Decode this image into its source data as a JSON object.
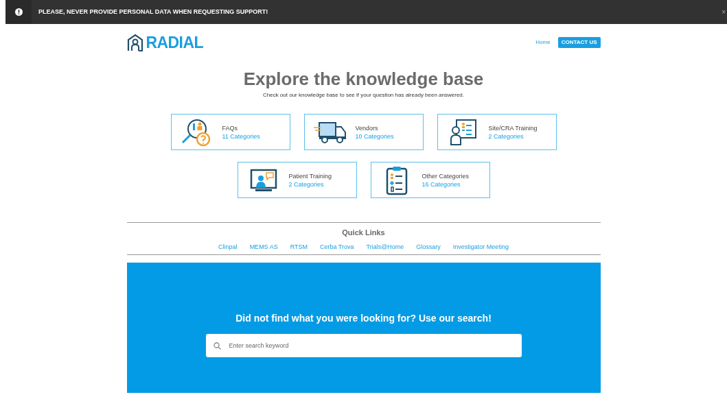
{
  "banner": {
    "text": "PLEASE, NEVER PROVIDE PERSONAL DATA WHEN REQUESTING SUPPORT!",
    "close": "×"
  },
  "header": {
    "logo": "RADIAL",
    "nav": [
      {
        "label": "Home",
        "kind": "link"
      },
      {
        "label": "CONTACT US",
        "kind": "button"
      }
    ]
  },
  "hero": {
    "title": "Explore the knowledge base",
    "subtitle": "Check out our knowledge base to see if your question has already been answered."
  },
  "cards": [
    [
      {
        "title": "FAQs",
        "count": "11 Categories",
        "kind": "faq"
      },
      {
        "title": "Vendors",
        "count": "10 Categories",
        "kind": "truck"
      },
      {
        "title": "Site/CRA Training",
        "count": "2 Categories",
        "kind": "doctor"
      }
    ],
    [
      {
        "title": "Patient Training",
        "count": "2 Categories",
        "kind": "screen"
      },
      {
        "title": "Other Categories",
        "count": "16 Categories",
        "kind": "clipboard"
      }
    ]
  ],
  "quick_links": {
    "title": "Quick Links",
    "links": [
      "Clinpal",
      "MEMS AS",
      "RTSM",
      "Cerba Trova",
      "Trials@Home",
      "Glossary",
      "Investigator Meeting"
    ]
  },
  "search": {
    "title": "Did not find what you were looking for? Use our search!",
    "placeholder": "Enter search keyword"
  }
}
